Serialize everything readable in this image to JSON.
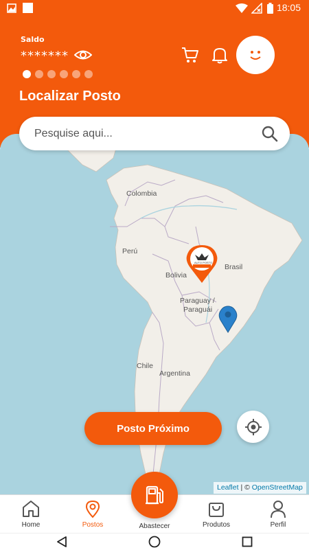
{
  "status_bar": {
    "time": "18:05"
  },
  "header": {
    "saldo_label": "Saldo",
    "saldo_value": "*******",
    "carousel_dots": 6,
    "active_dot": 0,
    "title": "Localizar Posto",
    "cart_icon": "cart-icon",
    "bell_icon": "bell-icon",
    "avatar_icon": "smiley-icon"
  },
  "search": {
    "placeholder": "Pesquise aqui..."
  },
  "map": {
    "labels": {
      "colombia": "Colombia",
      "peru": "Perú",
      "bolivia": "Bolivia",
      "brasil": "Brasil",
      "paraguay_1": "Paraguay /",
      "paraguay_2": "Paraguái",
      "chile": "Chile",
      "argentina": "Argentina"
    },
    "station_marker_text": "AUTO POSTO",
    "attribution": {
      "leaflet": "Leaflet",
      "sep": " | © ",
      "osm": "OpenStreetMap"
    }
  },
  "actions": {
    "posto_proximo": "Posto Próximo"
  },
  "nav": {
    "items": [
      {
        "label": "Home",
        "icon": "home-icon"
      },
      {
        "label": "Postos",
        "icon": "location-pin-icon"
      },
      {
        "label": "Abastecer",
        "icon": "fuel-pump-icon"
      },
      {
        "label": "Produtos",
        "icon": "shopping-bag-icon"
      },
      {
        "label": "Perfil",
        "icon": "person-icon"
      }
    ],
    "active": "Postos"
  },
  "colors": {
    "brand": "#f35a0c",
    "map_water": "#aad3df",
    "map_land": "#f2efe9"
  }
}
